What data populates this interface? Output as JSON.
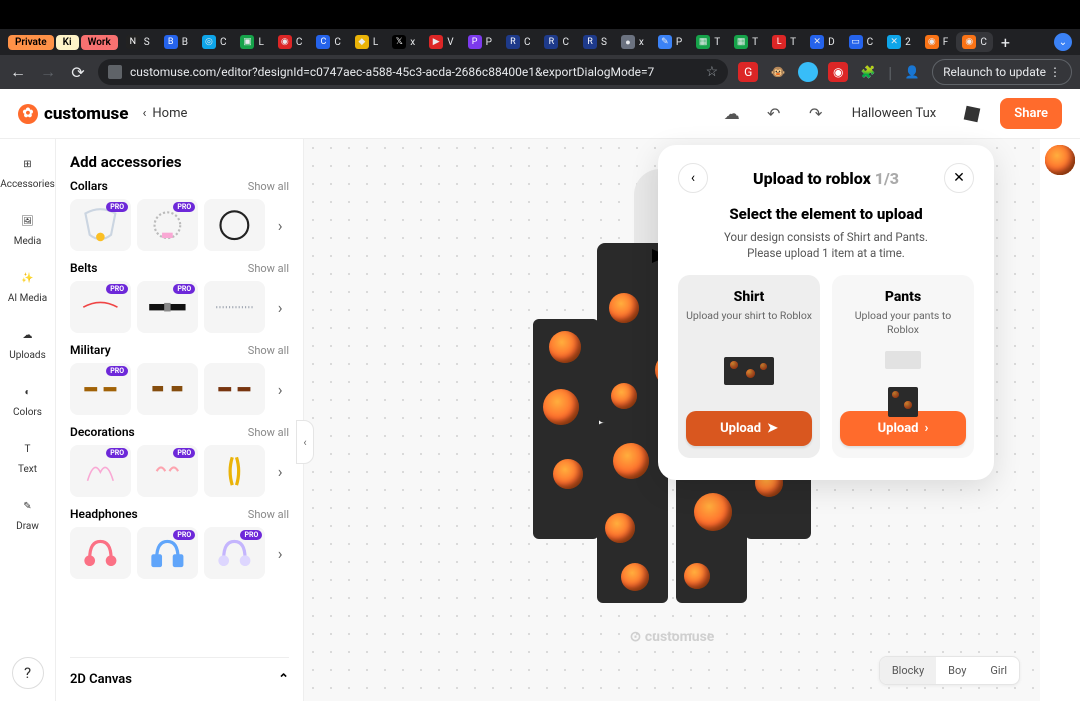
{
  "browser": {
    "badges": {
      "private": "Private",
      "ki": "Ki",
      "work": "Work"
    },
    "tabs": [
      "S",
      "B",
      "C",
      "L",
      "C",
      "C",
      "L",
      "x",
      "V",
      "P",
      "C",
      "C",
      "S",
      "x",
      "P",
      "T",
      "T",
      "T",
      "D",
      "C",
      "2",
      "F",
      "C"
    ],
    "url": "customuse.com/editor?designId=c0747aec-a588-45c3-acda-2686c88400e1&exportDialogMode=7",
    "relaunch": "Relaunch to update"
  },
  "header": {
    "brand": "customuse",
    "home": "Home",
    "doc_name": "Halloween Tux",
    "share": "Share"
  },
  "rail": {
    "accessories": "Accessories",
    "media": "Media",
    "ai_media": "AI Media",
    "uploads": "Uploads",
    "colors": "Colors",
    "text": "Text",
    "draw": "Draw"
  },
  "panel": {
    "title": "Add accessories",
    "show_all": "Show all",
    "pro": "PRO",
    "categories": [
      "Collars",
      "Belts",
      "Military",
      "Decorations",
      "Headphones"
    ],
    "canvas2d": "2D Canvas"
  },
  "canvas": {
    "watermark": "⊙ customuse",
    "toggles": [
      "Blocky",
      "Boy",
      "Girl"
    ]
  },
  "modal": {
    "title": "Upload to roblox",
    "step": "1/3",
    "subtitle": "Select the element to upload",
    "desc1": "Your design consists of Shirt and Pants.",
    "desc2": "Please upload 1 item at a time.",
    "shirt": {
      "title": "Shirt",
      "desc": "Upload your shirt to Roblox",
      "btn": "Upload"
    },
    "pants": {
      "title": "Pants",
      "desc": "Upload your pants to Roblox",
      "btn": "Upload"
    }
  }
}
